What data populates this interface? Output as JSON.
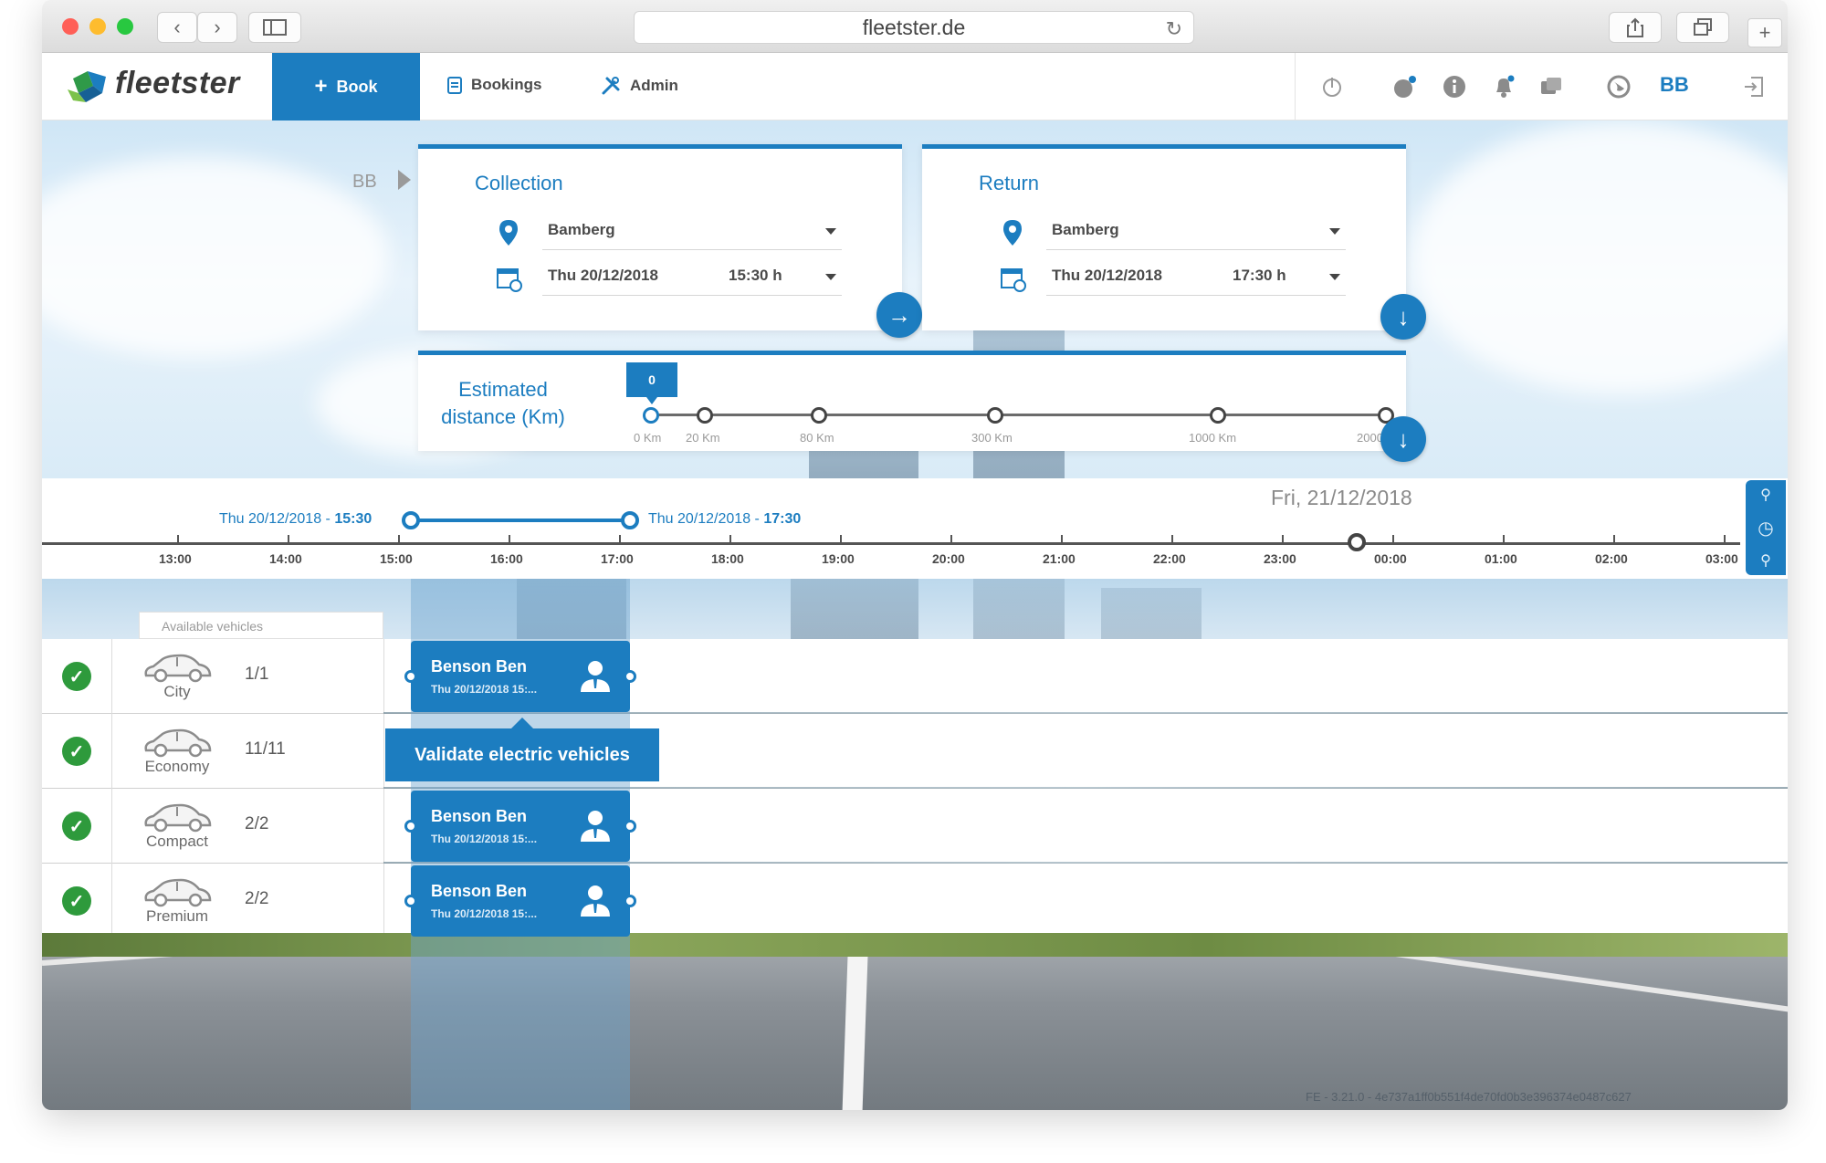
{
  "browser": {
    "url": "fleetster.de"
  },
  "navbar": {
    "logo_text": "fleetster",
    "book_label": "Book",
    "bookings_label": "Bookings",
    "admin_label": "Admin",
    "user_initials": "BB"
  },
  "search": {
    "user_initials": "BB",
    "collection": {
      "title": "Collection",
      "location": "Bamberg",
      "date": "Thu 20/12/2018",
      "time": "15:30 h"
    },
    "return": {
      "title": "Return",
      "location": "Bamberg",
      "date": "Thu 20/12/2018",
      "time": "17:30 h"
    },
    "distance": {
      "label_line1": "Estimated",
      "label_line2": "distance (Km)",
      "value": "0",
      "stops": [
        "0 Km",
        "20 Km",
        "80 Km",
        "300 Km",
        "1000 Km",
        "2000 Km"
      ]
    }
  },
  "timeline": {
    "start_date": "Thu 20/12/2018",
    "start_time": "15:30",
    "end_date": "Thu 20/12/2018",
    "end_time": "17:30",
    "separator": " - ",
    "next_day": "Fri, 21/12/2018",
    "hours": [
      "13:00",
      "14:00",
      "15:00",
      "16:00",
      "17:00",
      "18:00",
      "19:00",
      "20:00",
      "21:00",
      "22:00",
      "23:00",
      "00:00",
      "01:00",
      "02:00",
      "03:00"
    ]
  },
  "vehicles": {
    "header": "Available vehicles",
    "rows": [
      {
        "name": "City",
        "count": "1/1"
      },
      {
        "name": "Economy",
        "count": "11/11"
      },
      {
        "name": "Compact",
        "count": "2/2"
      },
      {
        "name": "Premium",
        "count": "2/2"
      }
    ]
  },
  "bookings": [
    {
      "name": "Benson Ben",
      "time": "Thu 20/12/2018 15:..."
    },
    {
      "name": "Benson Ben",
      "time": "Thu 20/12/2018 15:..."
    },
    {
      "name": "Benson Ben",
      "time": "Thu 20/12/2018 15:..."
    }
  ],
  "tooltip": "Validate electric vehicles",
  "footer": {
    "version": "FE - 3.21.0 - 4e737a1ff0b551f4de70fd0b3e396374e0487c627"
  },
  "colors": {
    "accent": "#1c7dc0",
    "success": "#2e9a3c"
  }
}
